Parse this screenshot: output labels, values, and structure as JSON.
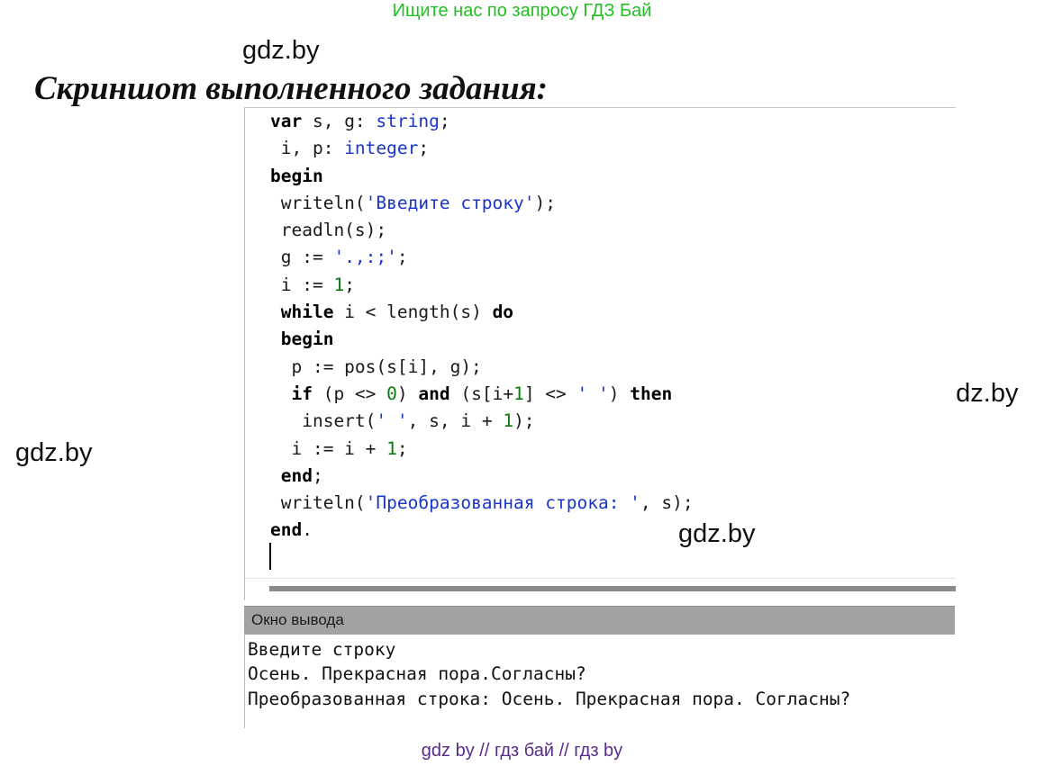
{
  "banner": "Ищите нас по запросу ГДЗ Бай",
  "watermark": "gdz.by",
  "heading": "Скриншот выполненного задания:",
  "code": [
    [
      {
        "t": "var",
        "c": "kw"
      },
      {
        "t": " s, g: ",
        "c": ""
      },
      {
        "t": "string",
        "c": "ty"
      },
      {
        "t": ";",
        "c": ""
      }
    ],
    [
      {
        "t": " i, p: ",
        "c": ""
      },
      {
        "t": "integer",
        "c": "ty"
      },
      {
        "t": ";",
        "c": ""
      }
    ],
    [
      {
        "t": "begin",
        "c": "kw"
      }
    ],
    [
      {
        "t": " writeln(",
        "c": ""
      },
      {
        "t": "'Введите строку'",
        "c": "st"
      },
      {
        "t": ");",
        "c": ""
      }
    ],
    [
      {
        "t": " readln(s);",
        "c": ""
      }
    ],
    [
      {
        "t": " g := ",
        "c": ""
      },
      {
        "t": "'.,:;'",
        "c": "st"
      },
      {
        "t": ";",
        "c": ""
      }
    ],
    [
      {
        "t": " i := ",
        "c": ""
      },
      {
        "t": "1",
        "c": "nu"
      },
      {
        "t": ";",
        "c": ""
      }
    ],
    [
      {
        "t": " ",
        "c": ""
      },
      {
        "t": "while",
        "c": "kw"
      },
      {
        "t": " i < length(s) ",
        "c": ""
      },
      {
        "t": "do",
        "c": "kw"
      }
    ],
    [
      {
        "t": " ",
        "c": ""
      },
      {
        "t": "begin",
        "c": "kw"
      }
    ],
    [
      {
        "t": "  p := pos(s[i], g);",
        "c": ""
      }
    ],
    [
      {
        "t": "  ",
        "c": ""
      },
      {
        "t": "if",
        "c": "kw"
      },
      {
        "t": " (p <> ",
        "c": ""
      },
      {
        "t": "0",
        "c": "nu"
      },
      {
        "t": ") ",
        "c": ""
      },
      {
        "t": "and",
        "c": "kw"
      },
      {
        "t": " (s[i+",
        "c": ""
      },
      {
        "t": "1",
        "c": "nu"
      },
      {
        "t": "] <> ",
        "c": ""
      },
      {
        "t": "' '",
        "c": "st"
      },
      {
        "t": ") ",
        "c": ""
      },
      {
        "t": "then",
        "c": "kw"
      }
    ],
    [
      {
        "t": "   insert(",
        "c": ""
      },
      {
        "t": "' '",
        "c": "st"
      },
      {
        "t": ", s, i + ",
        "c": ""
      },
      {
        "t": "1",
        "c": "nu"
      },
      {
        "t": ");",
        "c": ""
      }
    ],
    [
      {
        "t": "  i := i + ",
        "c": ""
      },
      {
        "t": "1",
        "c": "nu"
      },
      {
        "t": ";",
        "c": ""
      }
    ],
    [
      {
        "t": " ",
        "c": ""
      },
      {
        "t": "end",
        "c": "kw"
      },
      {
        "t": ";",
        "c": ""
      }
    ],
    [
      {
        "t": " writeln(",
        "c": ""
      },
      {
        "t": "'Преобразованная строка: '",
        "c": "st"
      },
      {
        "t": ", s);",
        "c": ""
      }
    ],
    [
      {
        "t": "end",
        "c": "kw"
      },
      {
        "t": ".",
        "c": ""
      }
    ]
  ],
  "output": {
    "title": "Окно вывода",
    "lines": [
      "Введите строку",
      "Осень. Прекрасная пора.Согласны?",
      "Преобразованная строка: Осень. Прекрасная пора. Согласны?"
    ]
  },
  "footer": "gdz by  //  гдз бай  //  гдз by"
}
